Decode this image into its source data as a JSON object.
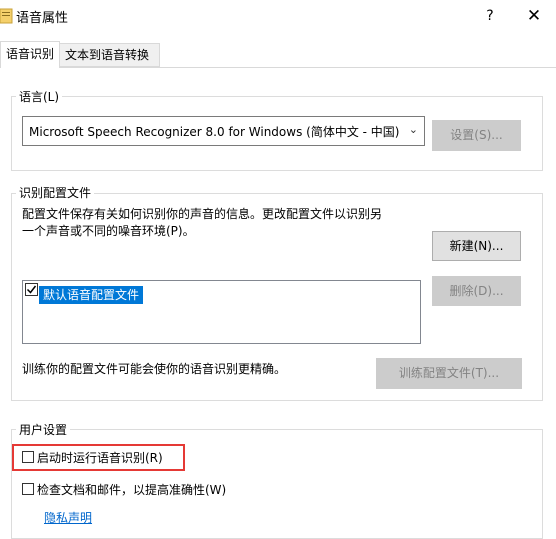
{
  "window": {
    "title": "语音属性",
    "help_glyph": "?",
    "close_glyph": "✕"
  },
  "tabs": [
    {
      "label": "语音识别",
      "active": true
    },
    {
      "label": "文本到语音转换",
      "active": false
    }
  ],
  "language_group": {
    "title": "语言(L)",
    "selected_language": "Microsoft Speech Recognizer 8.0 for Windows (简体中文 - 中国)",
    "settings_button": "设置(S)..."
  },
  "profile_group": {
    "title": "识别配置文件",
    "description_line1": "配置文件保存有关如何识别你的声音的信息。更改配置文件以识别另",
    "description_line2": "一个声音或不同的噪音环境(P)。",
    "new_button": "新建(N)...",
    "delete_button": "删除(D)...",
    "profiles": [
      {
        "label": "默认语音配置文件",
        "checked": true,
        "selected": true
      }
    ],
    "training_text": "训练你的配置文件可能会使你的语音识别更精确。",
    "train_button": "训练配置文件(T)..."
  },
  "user_settings": {
    "title": "用户设置",
    "run_at_startup": {
      "label": "启动时运行语音识别(R)",
      "checked": false
    },
    "review_documents": {
      "label": "检查文档和邮件，以提高准确性(W)",
      "checked": false
    },
    "privacy_link": "隐私声明"
  },
  "colors": {
    "highlight_box": "#e53935",
    "selection": "#0078d7",
    "link": "#0066cc"
  }
}
